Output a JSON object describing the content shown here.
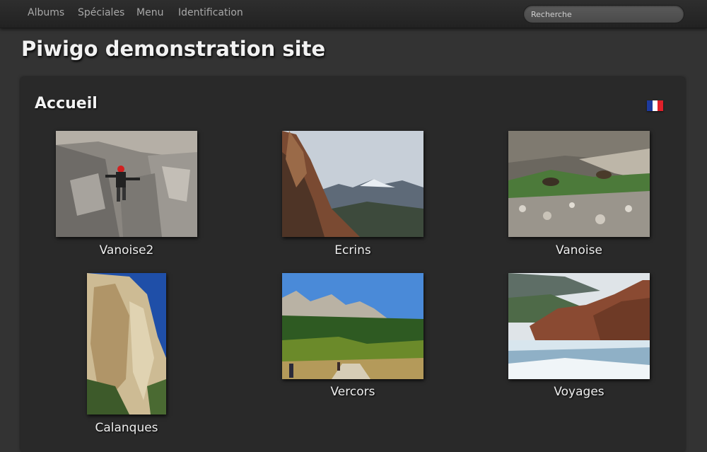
{
  "nav": {
    "items": [
      "Albums",
      "Spéciales",
      "Menu",
      "Identification"
    ]
  },
  "search": {
    "placeholder": "Recherche"
  },
  "site": {
    "title": "Piwigo demonstration site"
  },
  "breadcrumb": {
    "title": "Accueil"
  },
  "language": {
    "flag_icon": "france-flag-icon",
    "colors": [
      "#1d3a9e",
      "#ffffff",
      "#e0202a"
    ]
  },
  "albums": [
    {
      "name": "Vanoise2",
      "icon": "climber-photo"
    },
    {
      "name": "Ecrins",
      "icon": "mountain-photo"
    },
    {
      "name": "Vanoise",
      "icon": "ibex-photo"
    },
    {
      "name": "Calanques",
      "icon": "cliff-photo"
    },
    {
      "name": "Vercors",
      "icon": "forest-trail-photo"
    },
    {
      "name": "Voyages",
      "icon": "coast-photo"
    }
  ],
  "colors": {
    "background": "#333333",
    "panel": "#292929",
    "nav_text": "#a8a8a8",
    "title_text": "#f2f2f2"
  }
}
